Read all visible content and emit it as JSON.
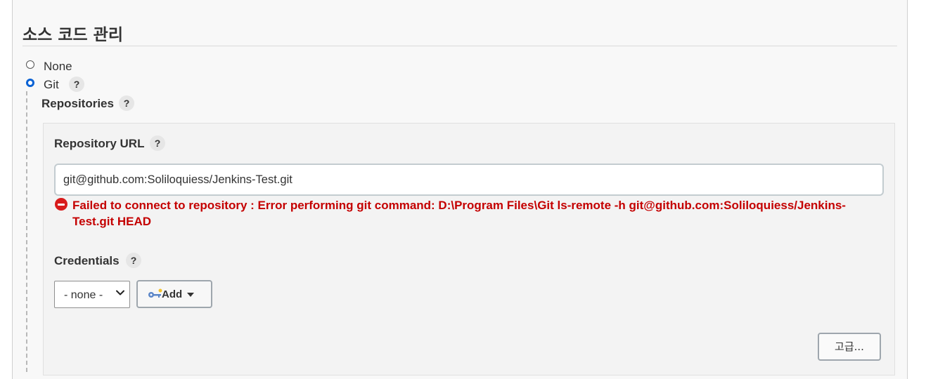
{
  "section": {
    "title": "소스 코드 관리"
  },
  "scm_options": [
    {
      "label": "None",
      "selected": false
    },
    {
      "label": "Git",
      "selected": true
    }
  ],
  "help_glyph": "?",
  "repositories": {
    "label": "Repositories",
    "repository_url": {
      "label": "Repository URL",
      "value": "git@github.com:Soliloquiess/Jenkins-Test.git",
      "error": "Failed to connect to repository : Error performing git command: D:\\Program Files\\Git ls-remote -h git@github.com:Soliloquiess/Jenkins-Test.git HEAD",
      "error_icon": "stop-icon"
    },
    "credentials": {
      "label": "Credentials",
      "selected": "- none -",
      "add_label": "Add",
      "add_icon": "key-icon"
    },
    "advanced_label": "고급..."
  },
  "colors": {
    "error": "#c40000",
    "radio_accent": "#0a62d4"
  }
}
